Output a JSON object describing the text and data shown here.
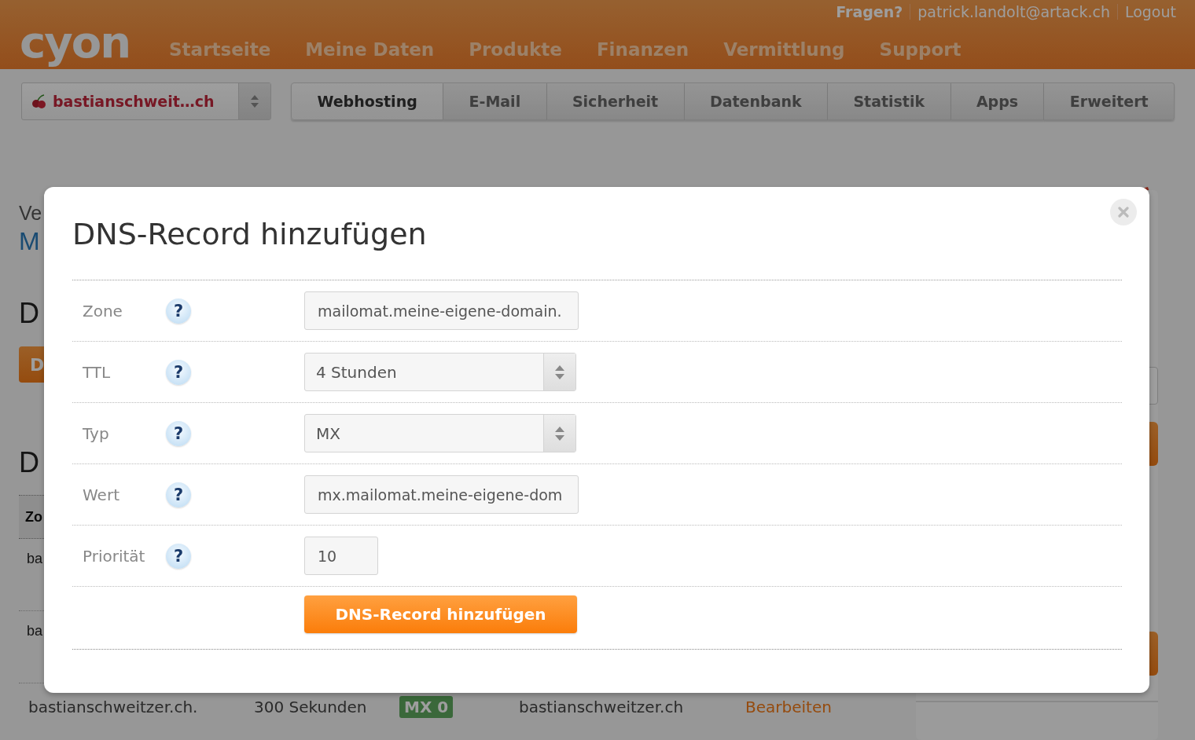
{
  "header": {
    "logo": "cyon",
    "nav": [
      "Startseite",
      "Meine Daten",
      "Produkte",
      "Finanzen",
      "Vermittlung",
      "Support"
    ],
    "top_links": [
      {
        "label": "Fragen?",
        "kind": "strong"
      },
      {
        "label": "patrick.landolt@artack.ch",
        "kind": "link"
      },
      {
        "label": "Logout",
        "kind": "link"
      }
    ]
  },
  "domain_select": {
    "value": "bastianschweit…ch"
  },
  "tabs": [
    {
      "label": "Webhosting",
      "selected": true
    },
    {
      "label": "E-Mail",
      "selected": false
    },
    {
      "label": "Sicherheit",
      "selected": false
    },
    {
      "label": "Datenbank",
      "selected": false
    },
    {
      "label": "Statistik",
      "selected": false
    },
    {
      "label": "Apps",
      "selected": false
    },
    {
      "label": "Erweitert",
      "selected": false
    }
  ],
  "background": {
    "overline": "Ve",
    "title": "M",
    "section_1": "D",
    "button": "D",
    "section_2": "D",
    "table": {
      "header": "Zo",
      "partial_rows": [
        "ba",
        "ba"
      ],
      "rows": [
        {
          "cells": [
            {
              "kind": "text",
              "text": "bastianschweitzer.ch."
            },
            {
              "kind": "text",
              "text": "300 Sekunden"
            },
            {
              "kind": "badge",
              "text": "MX 0"
            },
            {
              "kind": "text",
              "text": "bastianschweitzer.ch"
            },
            {
              "kind": "link",
              "text": "Bearbeiten"
            }
          ]
        }
      ]
    }
  },
  "dialog": {
    "title": "DNS-Record hinzufügen",
    "fields": [
      {
        "label": "Zone",
        "help": "?",
        "kind": "text",
        "value": "mailomat.meine-eigene-domain."
      },
      {
        "label": "TTL",
        "help": "?",
        "kind": "select",
        "value": "4 Stunden"
      },
      {
        "label": "Typ",
        "help": "?",
        "kind": "select",
        "value": "MX"
      },
      {
        "label": "Wert",
        "help": "?",
        "kind": "text",
        "value": "mx.mailomat.meine-eigene-dom"
      },
      {
        "label": "Priorität",
        "help": "?",
        "kind": "short",
        "value": "10"
      }
    ],
    "submit": "DNS-Record hinzufügen"
  }
}
